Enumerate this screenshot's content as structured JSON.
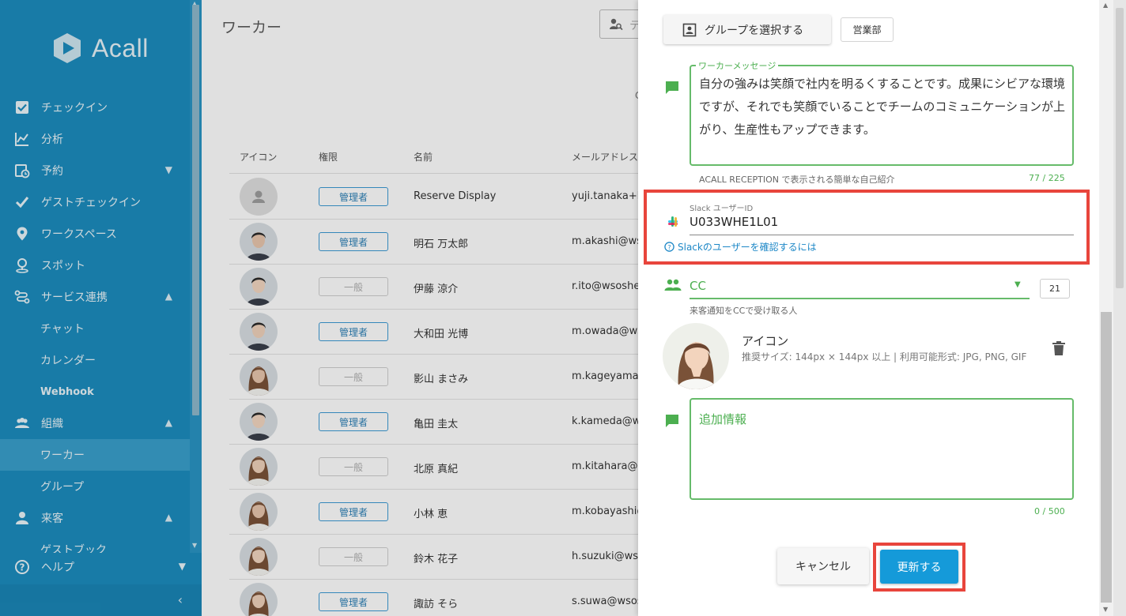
{
  "app": {
    "brand": "Acall"
  },
  "sidebar": {
    "items": [
      {
        "label": "チェックイン",
        "icon": "checkbox-icon"
      },
      {
        "label": "分析",
        "icon": "chart-line-icon"
      },
      {
        "label": "予約",
        "icon": "calendar-clock-icon",
        "expand": "down"
      },
      {
        "label": "ゲストチェックイン",
        "icon": "check-icon"
      },
      {
        "label": "ワークスペース",
        "icon": "location-pin-icon"
      },
      {
        "label": "スポット",
        "icon": "spot-pin-icon"
      },
      {
        "label": "サービス連携",
        "icon": "integration-icon",
        "expand": "up"
      },
      {
        "label": "チャット",
        "sub": true
      },
      {
        "label": "カレンダー",
        "sub": true
      },
      {
        "label": "Webhook",
        "sub": true
      },
      {
        "label": "組織",
        "icon": "people-group-icon",
        "expand": "up"
      },
      {
        "label": "ワーカー",
        "sub": true,
        "active": true
      },
      {
        "label": "グループ",
        "sub": true
      },
      {
        "label": "来客",
        "icon": "visitor-icon",
        "expand": "up"
      },
      {
        "label": "ゲストブック",
        "sub": true
      }
    ],
    "help_label": "ヘルプ"
  },
  "main": {
    "title": "ワーカー",
    "search_placeholder": "テ",
    "stray_text": "C",
    "columns": [
      "アイコン",
      "権限",
      "名前",
      "メールアドレス"
    ],
    "rows": [
      {
        "role": "管理者",
        "role_type": "admin",
        "name": "Reserve Display",
        "email": "yuji.tanaka+h"
      },
      {
        "role": "管理者",
        "role_type": "admin",
        "name": "明石 万太郎",
        "email": "m.akashi@ws"
      },
      {
        "role": "一般",
        "role_type": "general",
        "name": "伊藤 涼介",
        "email": "r.ito@wsoshe"
      },
      {
        "role": "管理者",
        "role_type": "admin",
        "name": "大和田 光博",
        "email": "m.owada@ws"
      },
      {
        "role": "一般",
        "role_type": "general",
        "name": "影山 まさみ",
        "email": "m.kageyama@"
      },
      {
        "role": "管理者",
        "role_type": "admin",
        "name": "亀田 圭太",
        "email": "k.kameda@w"
      },
      {
        "role": "一般",
        "role_type": "general",
        "name": "北原 真紀",
        "email": "m.kitahara@"
      },
      {
        "role": "管理者",
        "role_type": "admin",
        "name": "小林 恵",
        "email": "m.kobayashi@"
      },
      {
        "role": "一般",
        "role_type": "general",
        "name": "鈴木 花子",
        "email": "h.suzuki@wso"
      },
      {
        "role": "管理者",
        "role_type": "admin",
        "name": "諏訪 そら",
        "email": "s.suwa@wsos"
      }
    ]
  },
  "panel": {
    "select_group_label": "グループを選択する",
    "group_chip": "営業部",
    "message": {
      "legend": "ワーカーメッセージ",
      "text": "自分の強みは笑顔で社内を明るくすることです。成果にシビアな環境ですが、それでも笑顔でいることでチームのコミュニケーションが上がり、生産性もアップできます。",
      "helper": "ACALL RECEPTION で表示される簡単な自己紹介",
      "counter": "77 / 225"
    },
    "slack": {
      "label": "Slack ユーザーID",
      "value": "U033WHE1L01",
      "link": "Slackのユーザーを確認するには"
    },
    "cc": {
      "label": "CC",
      "count": "21",
      "helper": "来客通知をCCで受け取る人"
    },
    "icon_section": {
      "title": "アイコン",
      "desc": "推奨サイズ: 144px × 144px 以上 | 利用可能形式: JPG, PNG, GIF"
    },
    "extra": {
      "placeholder": "追加情報",
      "counter": "0 / 500"
    },
    "buttons": {
      "cancel": "キャンセル",
      "update": "更新する"
    }
  },
  "colors": {
    "sidebar_bg": "#1c8dbf",
    "accent_green": "#4caf50",
    "primary_blue": "#159ad9",
    "highlight_red": "#e8453c"
  }
}
